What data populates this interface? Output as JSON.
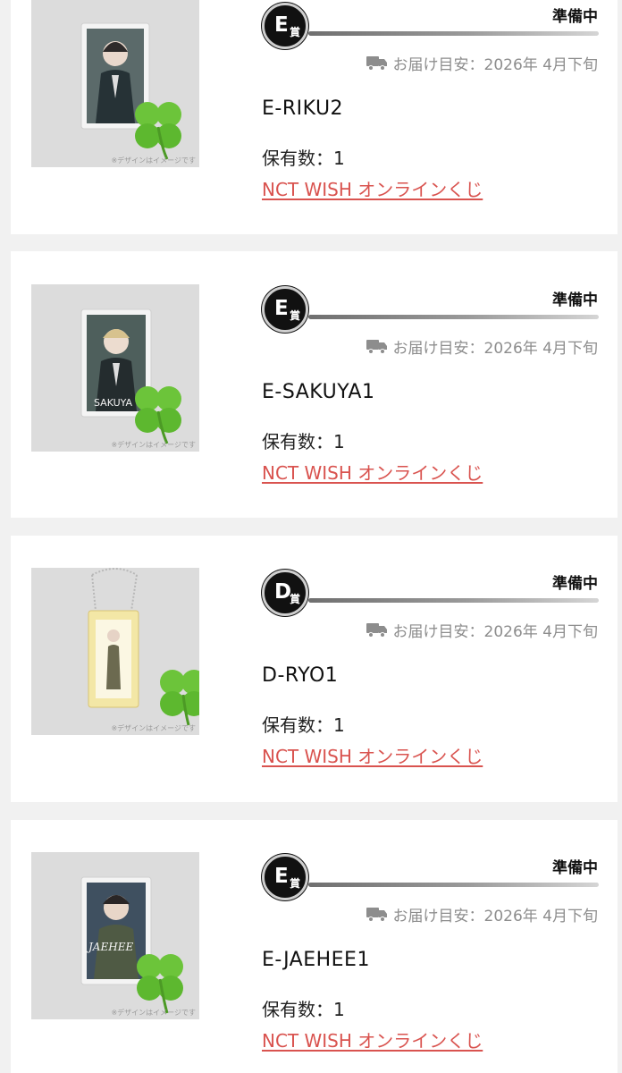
{
  "items": [
    {
      "grade_letter": "E",
      "grade_suffix": "賞",
      "status": "準備中",
      "delivery": "お届け目安：2026年 4月下旬",
      "title": "E-RIKU2",
      "qty": "保有数：1",
      "link": "NCT WISH オンラインくじ",
      "image_note": "※デザインはイメージです"
    },
    {
      "grade_letter": "E",
      "grade_suffix": "賞",
      "status": "準備中",
      "delivery": "お届け目安：2026年 4月下旬",
      "title": "E-SAKUYA1",
      "qty": "保有数：1",
      "link": "NCT WISH オンラインくじ",
      "image_note": "※デザインはイメージです"
    },
    {
      "grade_letter": "D",
      "grade_suffix": "賞",
      "status": "準備中",
      "delivery": "お届け目安：2026年 4月下旬",
      "title": "D-RYO1",
      "qty": "保有数：1",
      "link": "NCT WISH オンラインくじ",
      "image_note": "※デザインはイメージです"
    },
    {
      "grade_letter": "E",
      "grade_suffix": "賞",
      "status": "準備中",
      "delivery": "お届け目安：2026年 4月下旬",
      "title": "E-JAEHEE1",
      "qty": "保有数：1",
      "link": "NCT WISH オンラインくじ",
      "image_note": "※デザインはイメージです"
    }
  ],
  "colors": {
    "link": "#d9534f",
    "badge": "#111111",
    "status": "#111111",
    "delivery": "#8d8d8d"
  },
  "icons": {
    "delivery": "truck-icon",
    "clover": "clover-icon"
  }
}
